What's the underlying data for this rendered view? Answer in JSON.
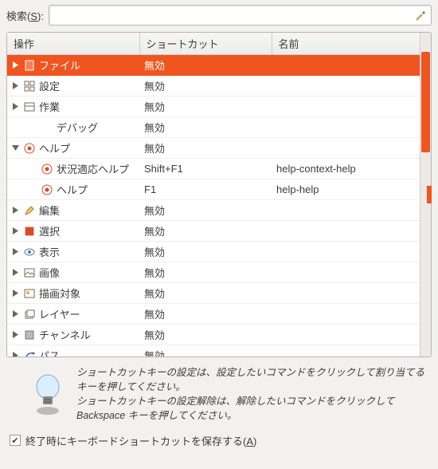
{
  "search": {
    "label_prefix": "検索(",
    "label_key": "S",
    "label_suffix": "):",
    "value": ""
  },
  "columns": {
    "op": "操作",
    "shortcut": "ショートカット",
    "name": "名前"
  },
  "rows": [
    {
      "indent": 0,
      "arrow": "right",
      "icon": "file-icon",
      "label": "ファイル",
      "shortcut": "無効",
      "name": "",
      "selected": true
    },
    {
      "indent": 0,
      "arrow": "right",
      "icon": "prefs-icon",
      "label": "設定",
      "shortcut": "無効",
      "name": ""
    },
    {
      "indent": 0,
      "arrow": "right",
      "icon": "work-icon",
      "label": "作業",
      "shortcut": "無効",
      "name": ""
    },
    {
      "indent": 1,
      "arrow": "",
      "icon": "",
      "label": "デバッグ",
      "shortcut": "無効",
      "name": ""
    },
    {
      "indent": 0,
      "arrow": "down",
      "icon": "help-icon",
      "label": "ヘルプ",
      "shortcut": "無効",
      "name": ""
    },
    {
      "indent": 1,
      "arrow": "",
      "icon": "help-icon",
      "label": "状況適応ヘルプ",
      "shortcut": "Shift+F1",
      "name": "help-context-help"
    },
    {
      "indent": 1,
      "arrow": "",
      "icon": "help-icon",
      "label": "ヘルプ",
      "shortcut": "F1",
      "name": "help-help"
    },
    {
      "indent": 0,
      "arrow": "right",
      "icon": "edit-icon",
      "label": "編集",
      "shortcut": "無効",
      "name": ""
    },
    {
      "indent": 0,
      "arrow": "right",
      "icon": "select-icon",
      "label": "選択",
      "shortcut": "無効",
      "name": ""
    },
    {
      "indent": 0,
      "arrow": "right",
      "icon": "view-icon",
      "label": "表示",
      "shortcut": "無効",
      "name": ""
    },
    {
      "indent": 0,
      "arrow": "right",
      "icon": "image-icon",
      "label": "画像",
      "shortcut": "無効",
      "name": ""
    },
    {
      "indent": 0,
      "arrow": "right",
      "icon": "drawable-icon",
      "label": "描画対象",
      "shortcut": "無効",
      "name": ""
    },
    {
      "indent": 0,
      "arrow": "right",
      "icon": "layer-icon",
      "label": "レイヤー",
      "shortcut": "無効",
      "name": ""
    },
    {
      "indent": 0,
      "arrow": "right",
      "icon": "channel-icon",
      "label": "チャンネル",
      "shortcut": "無効",
      "name": ""
    },
    {
      "indent": 0,
      "arrow": "right",
      "icon": "path-icon",
      "label": "パス",
      "shortcut": "無効",
      "name": ""
    }
  ],
  "hint": {
    "line1": "ショートカットキーの設定は、設定したいコマンドをクリックして割り当てるキーを押してください。",
    "line2": "ショートカットキーの設定解除は、解除したいコマンドをクリックして Backspace キーを押してください。"
  },
  "checkbox": {
    "checked": true,
    "label_prefix": "終了時にキーボードショートカットを保存する(",
    "label_key": "A",
    "label_suffix": ")"
  }
}
